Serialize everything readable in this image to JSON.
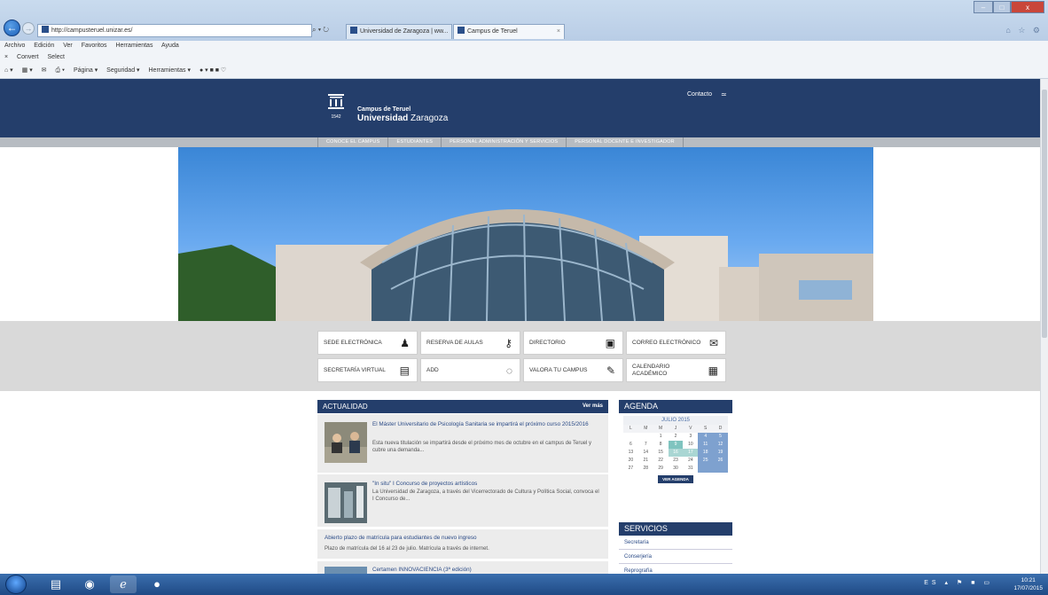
{
  "browser": {
    "address": "http://campusteruel.unizar.es/",
    "address_icons": "⌕ ▾ ↻",
    "tabs": [
      {
        "label": "Universidad de Zaragoza | ww..."
      },
      {
        "label": "Campus de Teruel",
        "close": "×"
      }
    ],
    "menu": [
      "Archivo",
      "Edición",
      "Ver",
      "Favoritos",
      "Herramientas",
      "Ayuda"
    ],
    "convert": {
      "close": "×",
      "convert": "Convert",
      "select": "Select"
    },
    "command": {
      "home": "⌂ ▾",
      "feeds": "▦ ▾",
      "mail": "✉",
      "print": "⎙ ▾",
      "pagina": "Página ▾",
      "seguridad": "Seguridad ▾",
      "herramientas": "Herramientas ▾",
      "extra": "● ▾ ■ ■ ♡"
    },
    "window_controls": {
      "min": "–",
      "max": "□",
      "close": "x"
    },
    "star_icons": "⌂ ☆ ⚙"
  },
  "site": {
    "campus_name": "Campus de Teruel",
    "uni_bold": "Universidad",
    "uni_rest": "Zaragoza",
    "logo_year": "1542",
    "contact": "Contacto",
    "rss": "≃"
  },
  "nav": [
    "CONOCE EL CAMPUS",
    "ESTUDIANTES",
    "PERSONAL ADMINISTRACIÓN Y SERVICIOS",
    "PERSONAL DOCENTE E INVESTIGADOR"
  ],
  "quicklinks": [
    {
      "label": "SEDE ELECTRÓNICA",
      "icon": "person-stamp-icon",
      "glyph": "♟"
    },
    {
      "label": "RESERVA DE AULAS",
      "icon": "key-icon",
      "glyph": "⚷"
    },
    {
      "label": "DIRECTORIO",
      "icon": "address-book-icon",
      "glyph": "▣"
    },
    {
      "label": "CORREO ELECTRÓNICO",
      "icon": "envelope-icon",
      "glyph": "✉"
    },
    {
      "label": "SECRETARÍA VIRTUAL",
      "icon": "document-icon",
      "glyph": "▤"
    },
    {
      "label": "ADD",
      "icon": "refresh-circle-icon",
      "glyph": "◌"
    },
    {
      "label": "VALORA TU CAMPUS",
      "icon": "checklist-icon",
      "glyph": "✎"
    },
    {
      "label": "CALENDARIO ACADÉMICO",
      "icon": "calendar-icon",
      "glyph": "▦"
    }
  ],
  "actualidad": {
    "title": "ACTUALIDAD",
    "more": "Ver más",
    "items": [
      {
        "title": "El Máster Universitario de Psicología Sanitaria se impartirá el próximo curso 2015/2016",
        "body": "Esta nueva titulación se impartirá desde el próximo mes de octubre en el campus de Teruel y cubre una demanda..."
      },
      {
        "title": "\"In situ\" I Concurso de proyectos artísticos",
        "body": "La Universidad de Zaragoza, a través del Vicerrectorado de Cultura y Política Social, convoca el I Concurso de..."
      },
      {
        "title": "Abierto plazo de matrícula para estudiantes de nuevo ingreso",
        "body": "Plazo de matrícula del 16 al 23 de julio. Matrícula a través de internet."
      },
      {
        "title": "Certamen INNOVACIENCIA (3ª edición)"
      }
    ]
  },
  "agenda": {
    "title": "AGENDA",
    "month": "JULIO 2015",
    "days": [
      "L",
      "M",
      "M",
      "J",
      "V",
      "S",
      "D"
    ],
    "weeks": [
      [
        "",
        "",
        "1",
        "2",
        "3",
        "4",
        "5"
      ],
      [
        "6",
        "7",
        "8",
        "9",
        "10",
        "11",
        "12"
      ],
      [
        "13",
        "14",
        "15",
        "16",
        "17",
        "18",
        "19"
      ],
      [
        "20",
        "21",
        "22",
        "23",
        "24",
        "25",
        "26"
      ],
      [
        "27",
        "28",
        "29",
        "30",
        "31",
        "",
        ""
      ]
    ],
    "button": "VER AGENDA"
  },
  "servicios": {
    "title": "SERVICIOS",
    "items": [
      "Secretaría",
      "Conserjería",
      "Reprografía"
    ]
  },
  "taskbar": {
    "tray": "ES ▴ ⚑ ■ ▭",
    "time": "10:21",
    "date": "17/07/2015"
  }
}
